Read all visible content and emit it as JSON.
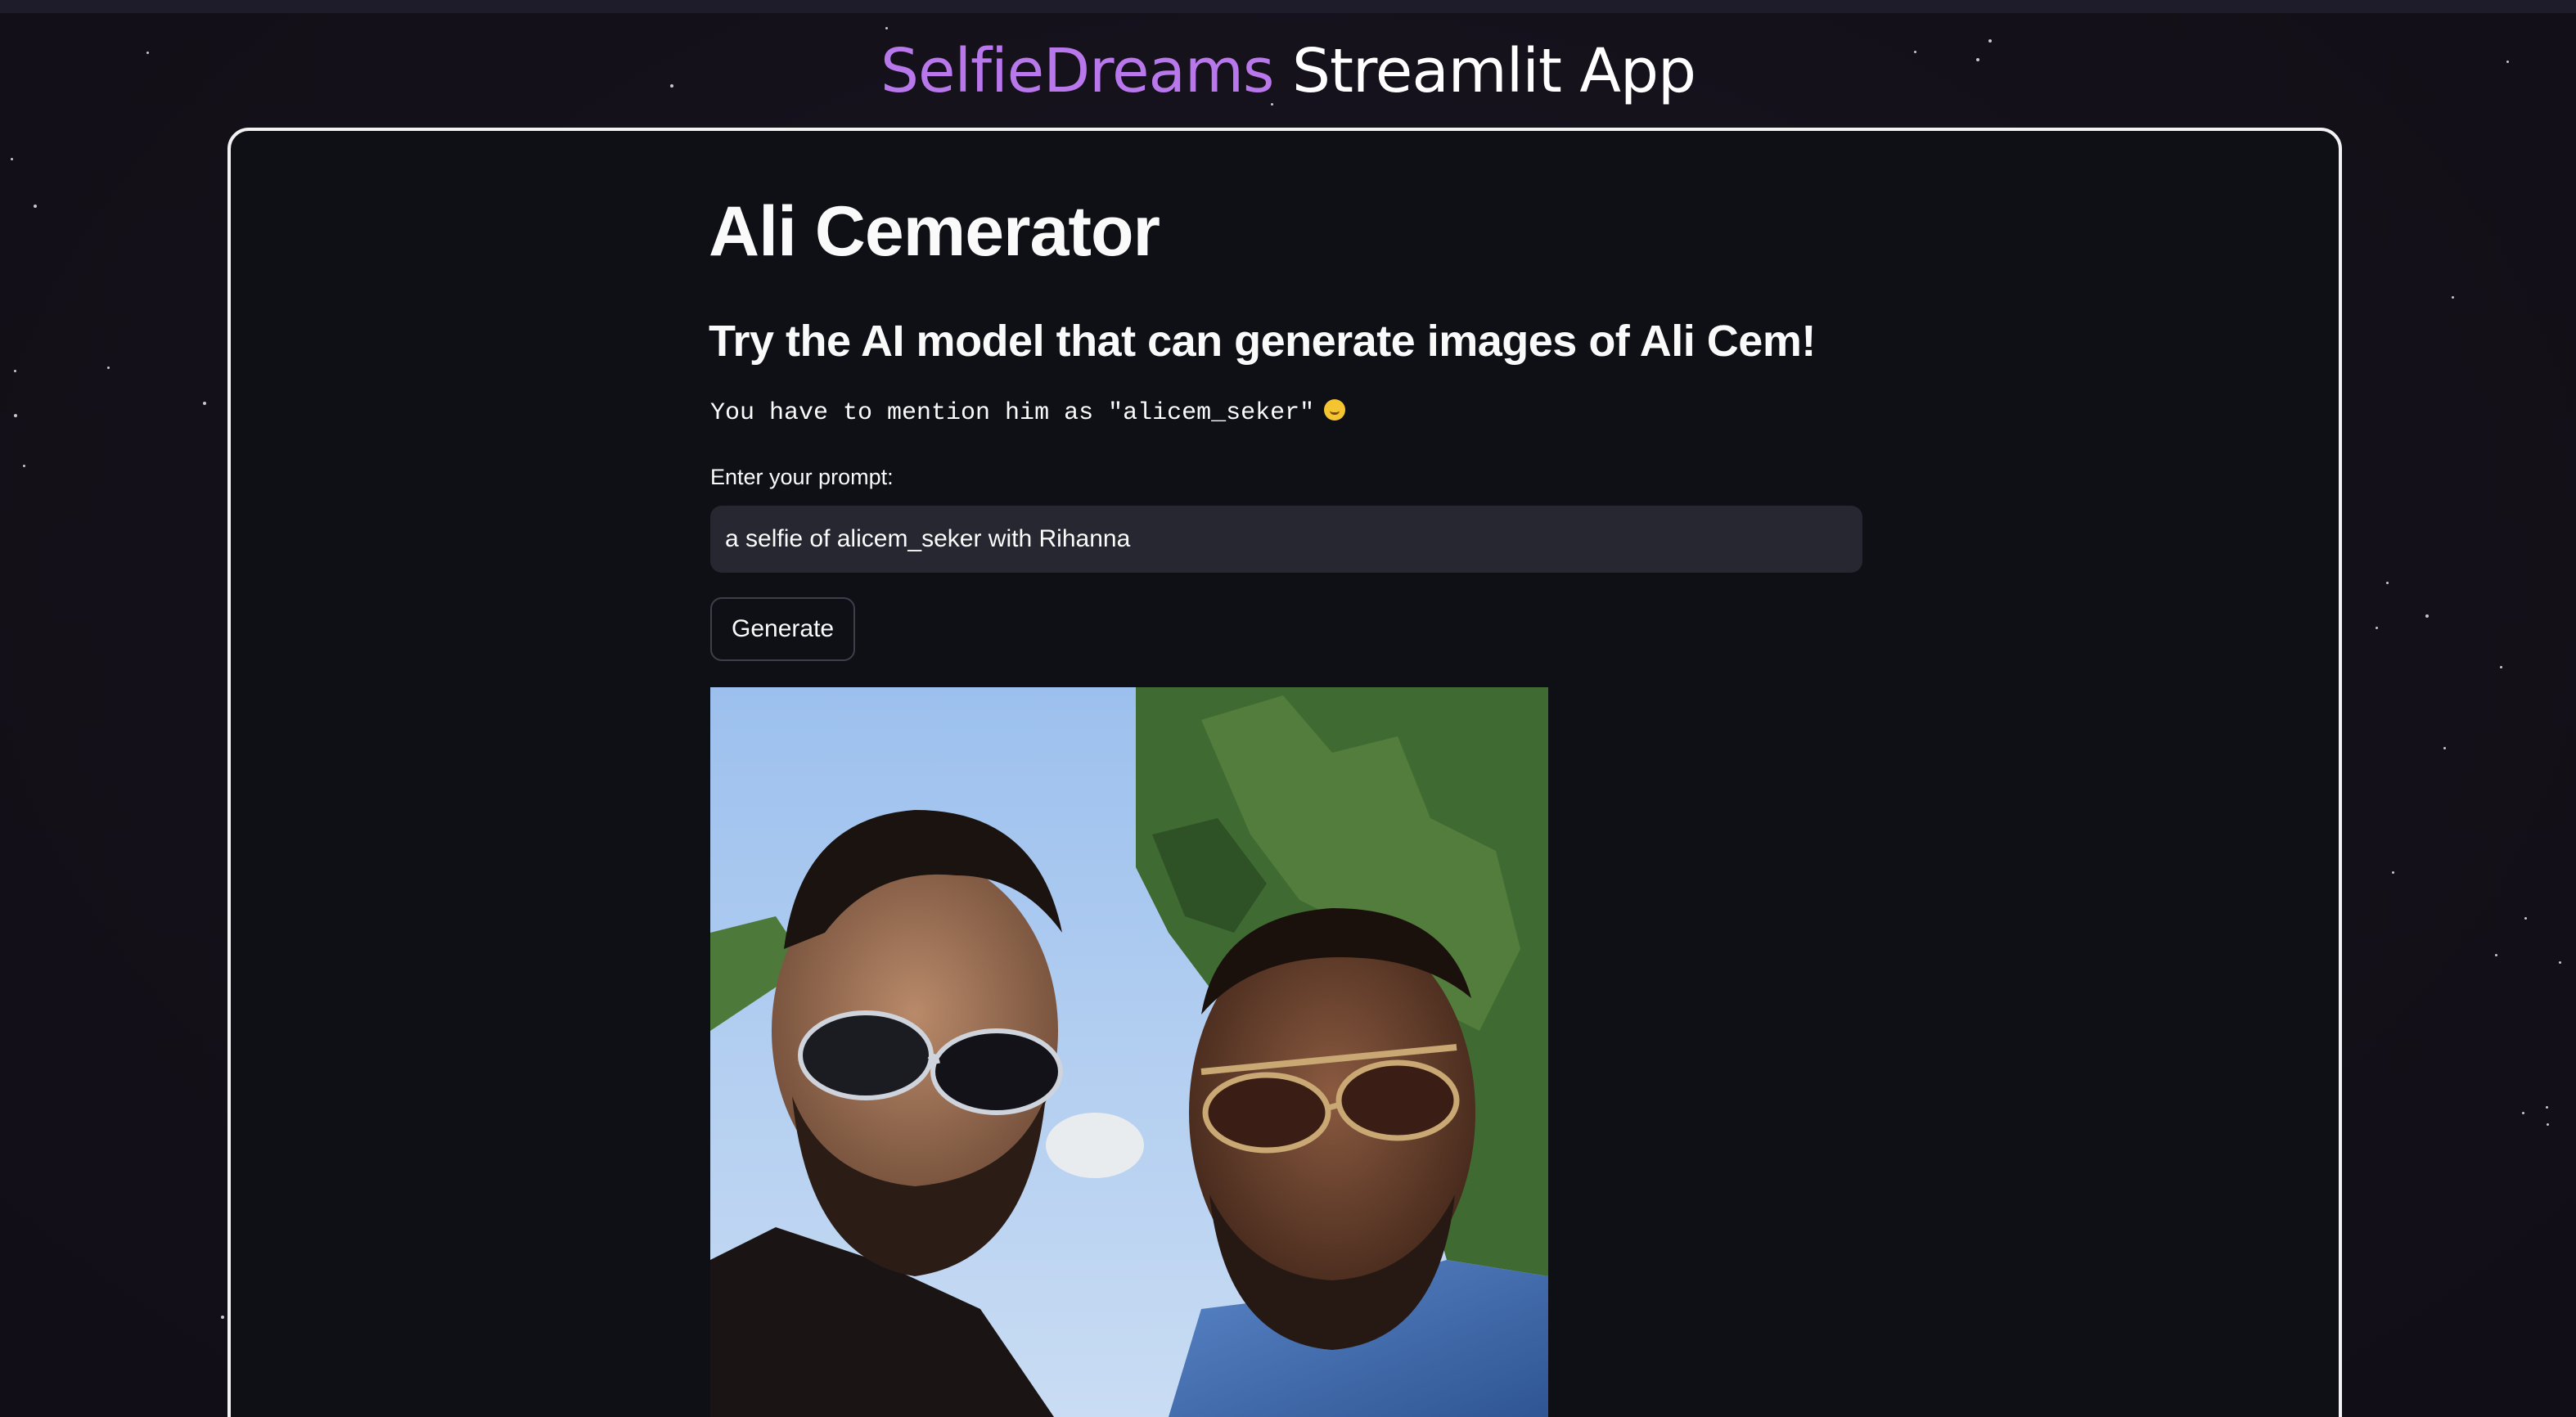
{
  "header": {
    "brand": "SelfieDreams",
    "title_rest": " Streamlit App"
  },
  "main": {
    "title": "Ali Cemerator",
    "subtitle": "Try the AI model that can generate images of Ali Cem!",
    "note": "You have to mention him as \"alicem_seker\"",
    "note_emoji": "upside-down-face-emoji",
    "prompt_label": "Enter your prompt:",
    "prompt_value": "a selfie of alicem_seker with Rihanna",
    "generate_label": "Generate",
    "image_description": "generated-selfie-image"
  },
  "colors": {
    "brand": "#b877ea",
    "background": "#14111b",
    "panel": "#0f1016",
    "input_bg": "#262730",
    "border": "#f2f2f2"
  }
}
